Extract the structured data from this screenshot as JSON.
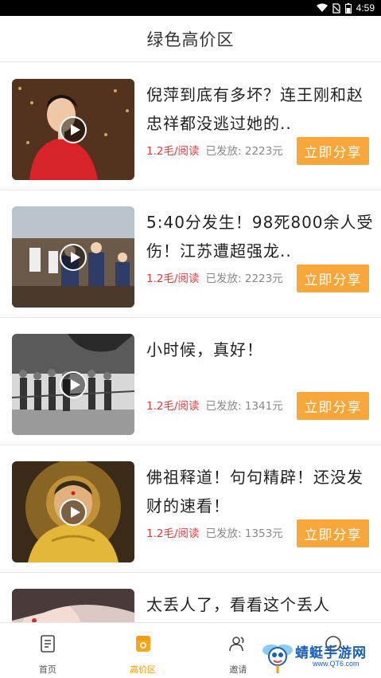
{
  "status_bar": {
    "time": "4:59"
  },
  "header": {
    "title": "绿色高价区"
  },
  "articles": [
    {
      "title": "倪萍到底有多坏？连王刚和赵忠祥都没逃过她的..",
      "rate": "1.2毛/阅读",
      "sent": "已发放: 2223元",
      "share_label": "立即分享"
    },
    {
      "title": "5:40分发生！98死800余人受伤！江苏遭超强龙..",
      "rate": "1.2毛/阅读",
      "sent": "已发放: 2223元",
      "share_label": "立即分享"
    },
    {
      "title": "小时候，真好！",
      "rate": "1.2毛/阅读",
      "sent": "已发放: 1341元",
      "share_label": "立即分享"
    },
    {
      "title": "佛祖释道！句句精辟！还没发财的速看！",
      "rate": "1.2毛/阅读",
      "sent": "已发放: 1353元",
      "share_label": "立即分享"
    },
    {
      "title": "太丢人了，看看这个丢人",
      "rate": "",
      "sent": "",
      "share_label": ""
    }
  ],
  "tabs": [
    {
      "label": "首页",
      "icon": "home-doc-icon",
      "active": false
    },
    {
      "label": "高价区",
      "icon": "premium-zone-icon",
      "active": true
    },
    {
      "label": "邀请",
      "icon": "user-invite-icon",
      "active": false
    },
    {
      "label": "",
      "icon": "smile-profile-icon",
      "active": false
    }
  ],
  "watermark": {
    "text": "蜻蜓手游网",
    "url": "www.QT6.com"
  },
  "colors": {
    "accent": "#f9a63a",
    "rate": "#e23b3b",
    "active_tab": "#f39c12"
  }
}
